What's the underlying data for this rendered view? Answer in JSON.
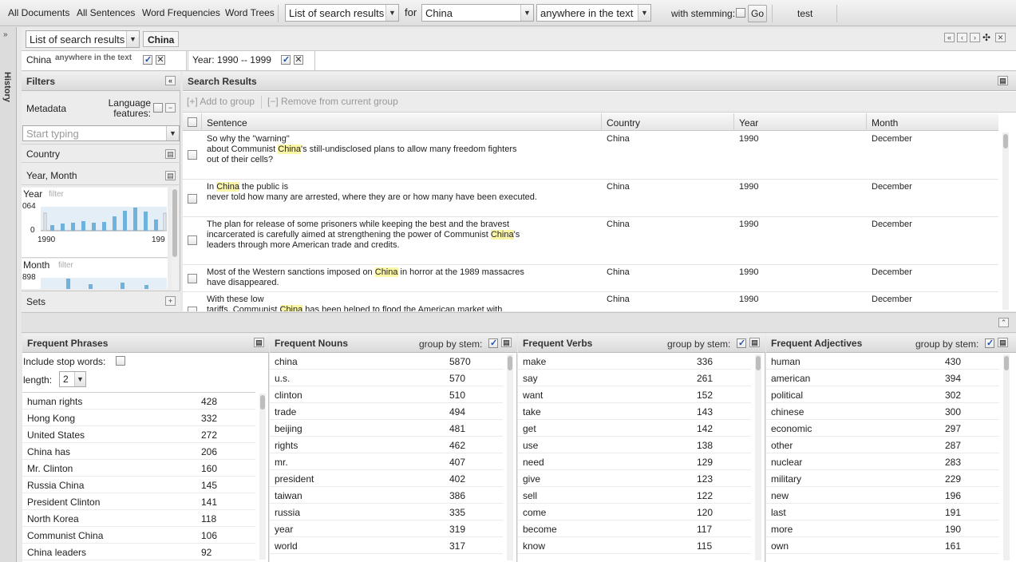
{
  "toolbar": {
    "tabs": [
      "All Documents",
      "All Sentences",
      "Word Frequencies",
      "Word Trees"
    ],
    "view_select": "List of search results",
    "for_label": "for",
    "query": "China",
    "scope_select": "anywhere in the text",
    "stemming_label": "with stemming:",
    "go_label": "Go",
    "test_label": "test"
  },
  "history": {
    "label": "History"
  },
  "query_bar": {
    "view_select": "List of search results",
    "query_chip": "China",
    "window_controls": [
      "«",
      "‹",
      "›",
      "✣",
      "✕"
    ]
  },
  "constraints": [
    {
      "term": "China",
      "scope": "anywhere in the text"
    },
    {
      "term": "Year: 1990 -- 1999"
    }
  ],
  "filters": {
    "title": "Filters",
    "metadata_label": "Metadata",
    "language_features_label": "Language features:",
    "search_placeholder": "Start typing",
    "country_label": "Country",
    "year_month_label": "Year, Month",
    "year_chart": {
      "label": "Year",
      "filter": "filter",
      "ymax": "064",
      "ymin": "0",
      "xmin": "1990",
      "xmax": "199"
    },
    "month_chart": {
      "label": "Month",
      "filter": "filter",
      "ymax": "898"
    },
    "sets_label": "Sets"
  },
  "search_results": {
    "title": "Search Results",
    "add_to_group": "Add to group",
    "remove_from_group": "Remove from current group",
    "columns": [
      "Sentence",
      "Country",
      "Year",
      "Month"
    ],
    "rows": [
      {
        "s1": "So why the \"warning\"",
        "s2a": "about Communist ",
        "s2h": "China",
        "s2b": "'s still-undisclosed plans to allow many freedom fighters",
        "s3": "out of their cells?",
        "country": "China",
        "year": "1990",
        "month": "December"
      },
      {
        "s1a": "In ",
        "s1h": "China",
        "s1b": " the public is",
        "s2": "never told how many are arrested, where they are or how many have been executed.",
        "country": "China",
        "year": "1990",
        "month": "December"
      },
      {
        "s1": "The plan for release of some prisoners while keeping the best and the bravest",
        "s2a": "incarcerated is carefully aimed at strengthening the power of Communist ",
        "s2h": "China",
        "s2b": "'s",
        "s3": "leaders through more American trade and credits.",
        "country": "China",
        "year": "1990",
        "month": "December"
      },
      {
        "s1a": "Most of the Western sanctions imposed on ",
        "s1h": "China",
        "s1b": " in horror at the 1989 massacres",
        "s2": "have disappeared.",
        "country": "China",
        "year": "1990",
        "month": "December"
      },
      {
        "s1": "With these low",
        "s2a": "tariffs, Communist ",
        "s2h": "China",
        "s2b": " has been helped to flood the American market with",
        "country": "China",
        "year": "1990",
        "month": "December"
      }
    ]
  },
  "frequent_phrases": {
    "title": "Frequent Phrases",
    "include_stop_words": "Include stop words:",
    "length_label": "length:",
    "length_value": "2",
    "items": [
      [
        "human rights",
        "428"
      ],
      [
        "Hong Kong",
        "332"
      ],
      [
        "United States",
        "272"
      ],
      [
        "China has",
        "206"
      ],
      [
        "Mr. Clinton",
        "160"
      ],
      [
        "Russia China",
        "145"
      ],
      [
        "President Clinton",
        "141"
      ],
      [
        "North Korea",
        "118"
      ],
      [
        "Communist China",
        "106"
      ],
      [
        "China leaders",
        "92"
      ]
    ]
  },
  "frequent_nouns": {
    "title": "Frequent Nouns",
    "group_by_stem": "group by stem:",
    "items": [
      [
        "china",
        "5870"
      ],
      [
        "u.s.",
        "570"
      ],
      [
        "clinton",
        "510"
      ],
      [
        "trade",
        "494"
      ],
      [
        "beijing",
        "481"
      ],
      [
        "rights",
        "462"
      ],
      [
        "mr.",
        "407"
      ],
      [
        "president",
        "402"
      ],
      [
        "taiwan",
        "386"
      ],
      [
        "russia",
        "335"
      ],
      [
        "year",
        "319"
      ],
      [
        "world",
        "317"
      ]
    ]
  },
  "frequent_verbs": {
    "title": "Frequent Verbs",
    "group_by_stem": "group by stem:",
    "items": [
      [
        "make",
        "336"
      ],
      [
        "say",
        "261"
      ],
      [
        "want",
        "152"
      ],
      [
        "take",
        "143"
      ],
      [
        "get",
        "142"
      ],
      [
        "use",
        "138"
      ],
      [
        "need",
        "129"
      ],
      [
        "give",
        "123"
      ],
      [
        "sell",
        "122"
      ],
      [
        "come",
        "120"
      ],
      [
        "become",
        "117"
      ],
      [
        "know",
        "115"
      ]
    ]
  },
  "frequent_adjectives": {
    "title": "Frequent Adjectives",
    "group_by_stem": "group by stem:",
    "items": [
      [
        "human",
        "430"
      ],
      [
        "american",
        "394"
      ],
      [
        "political",
        "302"
      ],
      [
        "chinese",
        "300"
      ],
      [
        "economic",
        "297"
      ],
      [
        "other",
        "287"
      ],
      [
        "nuclear",
        "283"
      ],
      [
        "military",
        "229"
      ],
      [
        "new",
        "196"
      ],
      [
        "last",
        "191"
      ],
      [
        "more",
        "190"
      ],
      [
        "own",
        "161"
      ]
    ]
  }
}
